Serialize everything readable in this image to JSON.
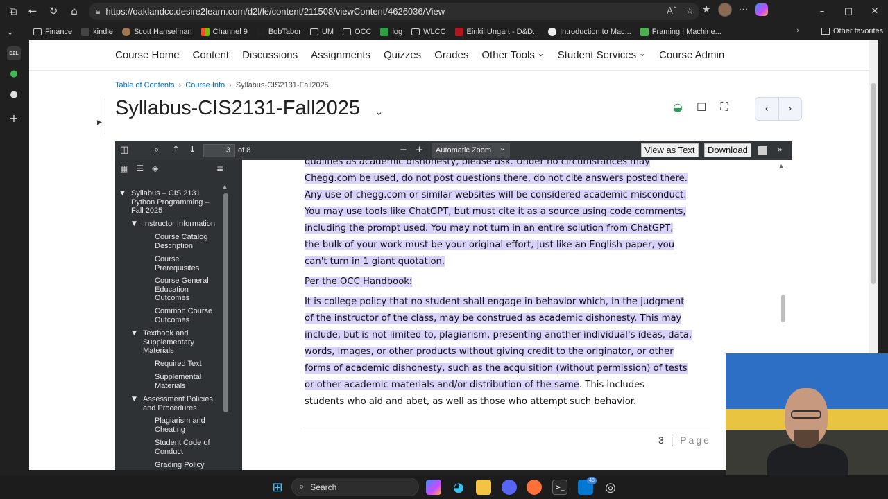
{
  "browser": {
    "url": "https://oaklandcc.desire2learn.com/d2l/le/content/211508/viewContent/4626036/View",
    "favorites": [
      {
        "label": "Finance",
        "icon": "folder-icon"
      },
      {
        "label": "kindle",
        "icon": "kindle-icon"
      },
      {
        "label": "Scott Hanselman",
        "icon": "hanselman-icon"
      },
      {
        "label": "Channel 9",
        "icon": "channel9-icon"
      },
      {
        "label": "BobTabor",
        "icon": "bobtabor-icon"
      },
      {
        "label": "UM",
        "icon": "folder-icon"
      },
      {
        "label": "OCC",
        "icon": "folder-icon"
      },
      {
        "label": "log",
        "icon": "log-icon"
      },
      {
        "label": "WLCC",
        "icon": "folder-icon"
      },
      {
        "label": "Einkil Ungart - D&D...",
        "icon": "dnd-icon"
      },
      {
        "label": "Introduction to Mac...",
        "icon": "github-icon"
      },
      {
        "label": "Framing | Machine...",
        "icon": "framing-icon"
      }
    ],
    "other_favorites": "Other favorites"
  },
  "nav": {
    "items": [
      {
        "label": "Course Home",
        "dropdown": false
      },
      {
        "label": "Content",
        "dropdown": false
      },
      {
        "label": "Discussions",
        "dropdown": false
      },
      {
        "label": "Assignments",
        "dropdown": false
      },
      {
        "label": "Quizzes",
        "dropdown": false
      },
      {
        "label": "Grades",
        "dropdown": false
      },
      {
        "label": "Other Tools",
        "dropdown": true
      },
      {
        "label": "Student Services",
        "dropdown": true
      },
      {
        "label": "Course Admin",
        "dropdown": false
      }
    ]
  },
  "breadcrumb": {
    "items": [
      "Table of Contents",
      "Course Info",
      "Syllabus-CIS2131-Fall2025"
    ]
  },
  "page_title": "Syllabus-CIS2131-Fall2025",
  "viewer": {
    "page_number": "3",
    "of_pages": "of 8",
    "zoom": "Automatic Zoom",
    "view_as_text": "View as Text",
    "download": "Download",
    "outline": [
      {
        "label": "Syllabus – CIS 2131 Python Programming – Fall 2025",
        "level": 0,
        "expanded": true
      },
      {
        "label": "Instructor Information",
        "level": 1,
        "expanded": true
      },
      {
        "label": "Course Catalog Description",
        "level": 2,
        "expanded": false
      },
      {
        "label": "Course Prerequisites",
        "level": 2,
        "expanded": false
      },
      {
        "label": "Course General Education Outcomes",
        "level": 2,
        "expanded": false
      },
      {
        "label": "Common Course Outcomes",
        "level": 2,
        "expanded": false
      },
      {
        "label": "Textbook and Supplementary Materials",
        "level": 1,
        "expanded": true
      },
      {
        "label": "Required Text",
        "level": 2,
        "expanded": false
      },
      {
        "label": "Supplemental Materials",
        "level": 2,
        "expanded": false
      },
      {
        "label": "Assessment Policies and Procedures",
        "level": 1,
        "expanded": true
      },
      {
        "label": "Plagiarism and Cheating",
        "level": 2,
        "expanded": false
      },
      {
        "label": "Student Code of Conduct",
        "level": 2,
        "expanded": false
      },
      {
        "label": "Grading Policy",
        "level": 2,
        "expanded": false
      }
    ],
    "document": {
      "para1_lines": [
        "qualifies as academic dishonesty, please ask.  Under no circumstances may",
        "Chegg.com be used, do not post questions there, do not cite answers posted there.",
        "Any use of chegg.com or similar websites will be considered academic misconduct.",
        "You may use tools like ChatGPT, but must cite it as a source using code comments,",
        "including the prompt used. You may not turn in an entire solution from ChatGPT,",
        "the bulk of your work must be your original effort, just like an English paper, you",
        "can't turn in 1 giant quotation."
      ],
      "heading": "Per the OCC Handbook:",
      "para2_lines": [
        "It is college policy that no student shall engage in behavior which, in the judgment",
        "of the instructor of the class, may be construed as academic dishonesty. This may",
        "include, but is not limited to, plagiarism, presenting another individual's ideas, data,",
        "words, images, or other products without giving credit to the originator, or other",
        "forms of academic dishonesty, such as the acquisition (without permission) of tests"
      ],
      "para2_last_highlighted": "or other academic materials and/or distribution of the same",
      "para2_last_rest": ". This includes",
      "para2_final": "students who aid and abet, as well as those who attempt such behavior.",
      "footer_num": "3",
      "footer_sep": "|",
      "footer_label": "Page"
    }
  },
  "taskbar": {
    "search_label": "Search",
    "badge": "48"
  },
  "colors": {
    "highlight": "#d9d2fb",
    "link": "#006fbf",
    "viewer_toolbar": "#323639"
  }
}
